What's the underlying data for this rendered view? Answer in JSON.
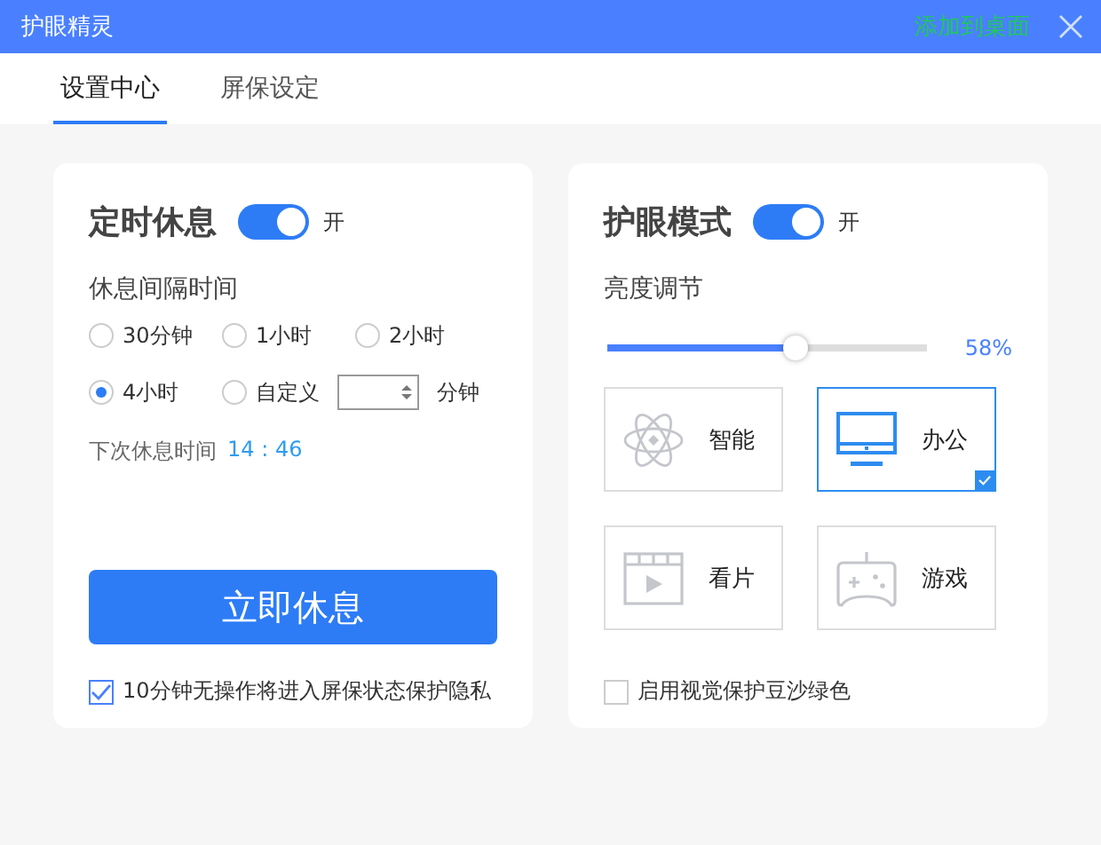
{
  "window": {
    "title": "护眼精灵",
    "action": "添加到桌面"
  },
  "tabs": [
    {
      "label": "设置中心",
      "selected": true
    },
    {
      "label": "屏保设定",
      "selected": false
    }
  ],
  "rest": {
    "title": "定时休息",
    "on": true,
    "switch_label": "开",
    "interval_label": "休息间隔时间",
    "options": [
      {
        "label": "30分钟",
        "selected": false
      },
      {
        "label": "1小时",
        "selected": false
      },
      {
        "label": "2小时",
        "selected": false
      },
      {
        "label": "4小时",
        "selected": true,
        "kind": "fixed"
      },
      {
        "label": "自定义",
        "selected": false,
        "kind": "custom",
        "unit": "分钟"
      }
    ],
    "next_label": "下次休息时间",
    "next_time": "14 : 46",
    "button": "立即休息",
    "privacy": {
      "label": "10分钟无操作将进入屏保状态保护隐私",
      "checked": true
    }
  },
  "eye": {
    "title": "护眼模式",
    "on": true,
    "switch_label": "开",
    "brightness_label": "亮度调节",
    "brightness": {
      "level": 0.58,
      "reading": "58%"
    },
    "modes": [
      {
        "label": "智能",
        "kind": "smart",
        "selected": false
      },
      {
        "label": "办公",
        "kind": "office",
        "selected": true
      },
      {
        "label": "看片",
        "kind": "movie",
        "selected": false
      },
      {
        "label": "游戏",
        "kind": "game",
        "selected": false
      }
    ],
    "green": {
      "label": "启用视觉保护豆沙绿色",
      "checked": false
    }
  }
}
